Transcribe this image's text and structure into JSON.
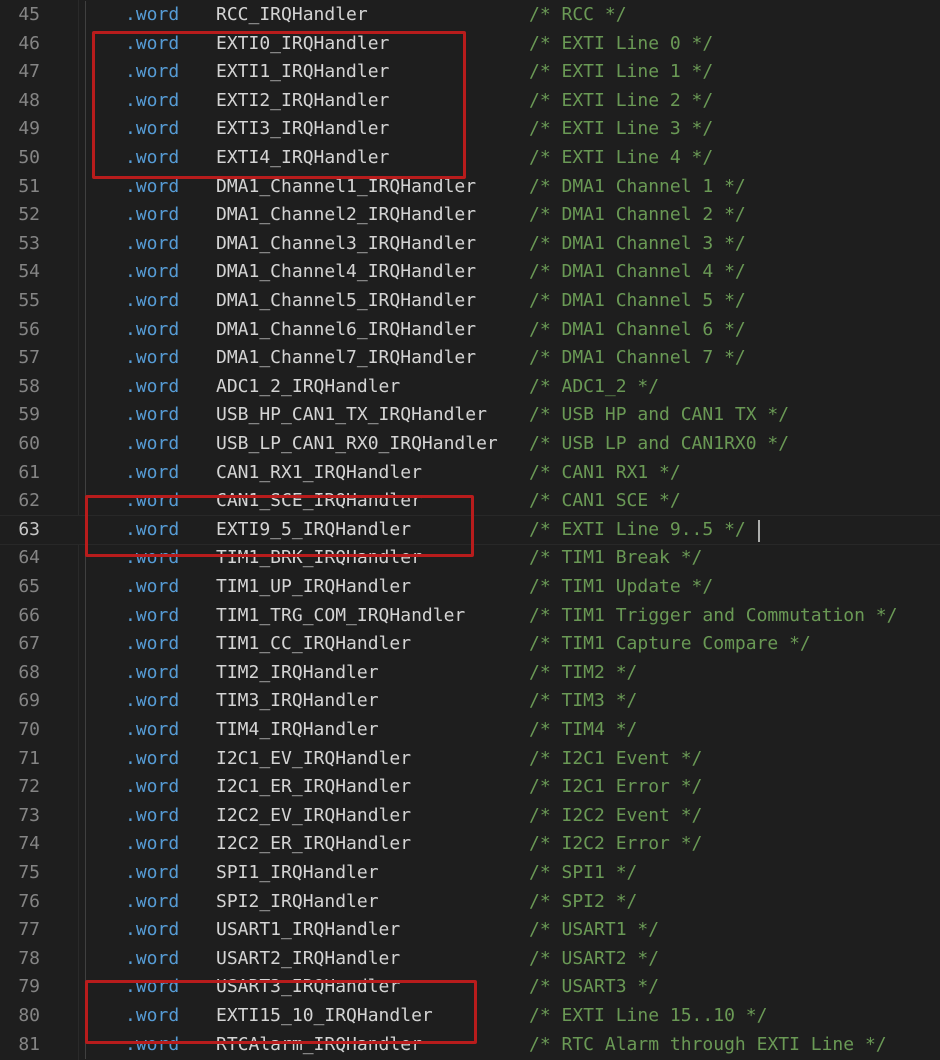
{
  "editor": {
    "lines": [
      {
        "num": "45",
        "directive": ".word",
        "symbol": "RCC_IRQHandler",
        "comment": "/* RCC */"
      },
      {
        "num": "46",
        "directive": ".word",
        "symbol": "EXTI0_IRQHandler",
        "comment": "/* EXTI Line 0 */"
      },
      {
        "num": "47",
        "directive": ".word",
        "symbol": "EXTI1_IRQHandler",
        "comment": "/* EXTI Line 1 */"
      },
      {
        "num": "48",
        "directive": ".word",
        "symbol": "EXTI2_IRQHandler",
        "comment": "/* EXTI Line 2 */"
      },
      {
        "num": "49",
        "directive": ".word",
        "symbol": "EXTI3_IRQHandler",
        "comment": "/* EXTI Line 3 */"
      },
      {
        "num": "50",
        "directive": ".word",
        "symbol": "EXTI4_IRQHandler",
        "comment": "/* EXTI Line 4 */"
      },
      {
        "num": "51",
        "directive": ".word",
        "symbol": "DMA1_Channel1_IRQHandler",
        "comment": "/* DMA1 Channel 1 */"
      },
      {
        "num": "52",
        "directive": ".word",
        "symbol": "DMA1_Channel2_IRQHandler",
        "comment": "/* DMA1 Channel 2 */"
      },
      {
        "num": "53",
        "directive": ".word",
        "symbol": "DMA1_Channel3_IRQHandler",
        "comment": "/* DMA1 Channel 3 */"
      },
      {
        "num": "54",
        "directive": ".word",
        "symbol": "DMA1_Channel4_IRQHandler",
        "comment": "/* DMA1 Channel 4 */"
      },
      {
        "num": "55",
        "directive": ".word",
        "symbol": "DMA1_Channel5_IRQHandler",
        "comment": "/* DMA1 Channel 5 */"
      },
      {
        "num": "56",
        "directive": ".word",
        "symbol": "DMA1_Channel6_IRQHandler",
        "comment": "/* DMA1 Channel 6 */"
      },
      {
        "num": "57",
        "directive": ".word",
        "symbol": "DMA1_Channel7_IRQHandler",
        "comment": "/* DMA1 Channel 7 */"
      },
      {
        "num": "58",
        "directive": ".word",
        "symbol": "ADC1_2_IRQHandler",
        "comment": "/* ADC1_2 */"
      },
      {
        "num": "59",
        "directive": ".word",
        "symbol": "USB_HP_CAN1_TX_IRQHandler",
        "comment": "/* USB HP and CAN1 TX */"
      },
      {
        "num": "60",
        "directive": ".word",
        "symbol": "USB_LP_CAN1_RX0_IRQHandler",
        "comment": "/* USB LP and CAN1RX0 */"
      },
      {
        "num": "61",
        "directive": ".word",
        "symbol": "CAN1_RX1_IRQHandler",
        "comment": "/* CAN1 RX1 */"
      },
      {
        "num": "62",
        "directive": ".word",
        "symbol": "CAN1_SCE_IRQHandler",
        "comment": "/* CAN1 SCE */"
      },
      {
        "num": "63",
        "directive": ".word",
        "symbol": "EXTI9_5_IRQHandler",
        "comment": "/* EXTI Line 9..5 */"
      },
      {
        "num": "64",
        "directive": ".word",
        "symbol": "TIM1_BRK_IRQHandler",
        "comment": "/* TIM1 Break */"
      },
      {
        "num": "65",
        "directive": ".word",
        "symbol": "TIM1_UP_IRQHandler",
        "comment": "/* TIM1 Update */"
      },
      {
        "num": "66",
        "directive": ".word",
        "symbol": "TIM1_TRG_COM_IRQHandler",
        "comment": "/* TIM1 Trigger and Commutation */"
      },
      {
        "num": "67",
        "directive": ".word",
        "symbol": "TIM1_CC_IRQHandler",
        "comment": "/* TIM1 Capture Compare */"
      },
      {
        "num": "68",
        "directive": ".word",
        "symbol": "TIM2_IRQHandler",
        "comment": "/* TIM2 */"
      },
      {
        "num": "69",
        "directive": ".word",
        "symbol": "TIM3_IRQHandler",
        "comment": "/* TIM3 */"
      },
      {
        "num": "70",
        "directive": ".word",
        "symbol": "TIM4_IRQHandler",
        "comment": "/* TIM4 */"
      },
      {
        "num": "71",
        "directive": ".word",
        "symbol": "I2C1_EV_IRQHandler",
        "comment": "/* I2C1 Event */"
      },
      {
        "num": "72",
        "directive": ".word",
        "symbol": "I2C1_ER_IRQHandler",
        "comment": "/* I2C1 Error */"
      },
      {
        "num": "73",
        "directive": ".word",
        "symbol": "I2C2_EV_IRQHandler",
        "comment": "/* I2C2 Event */"
      },
      {
        "num": "74",
        "directive": ".word",
        "symbol": "I2C2_ER_IRQHandler",
        "comment": "/* I2C2 Error */"
      },
      {
        "num": "75",
        "directive": ".word",
        "symbol": "SPI1_IRQHandler",
        "comment": "/* SPI1 */"
      },
      {
        "num": "76",
        "directive": ".word",
        "symbol": "SPI2_IRQHandler",
        "comment": "/* SPI2 */"
      },
      {
        "num": "77",
        "directive": ".word",
        "symbol": "USART1_IRQHandler",
        "comment": "/* USART1 */"
      },
      {
        "num": "78",
        "directive": ".word",
        "symbol": "USART2_IRQHandler",
        "comment": "/* USART2 */"
      },
      {
        "num": "79",
        "directive": ".word",
        "symbol": "USART3_IRQHandler",
        "comment": "/* USART3 */"
      },
      {
        "num": "80",
        "directive": ".word",
        "symbol": "EXTI15_10_IRQHandler",
        "comment": "/* EXTI Line 15..10 */"
      },
      {
        "num": "81",
        "directive": ".word",
        "symbol": "RTCAlarm_IRQHandler",
        "comment": "/* RTC Alarm through EXTI Line */"
      }
    ],
    "current_line": "63",
    "highlight_color": "#b81c1c",
    "keyword_color": "#569cd6",
    "comment_color": "#6a9955"
  }
}
